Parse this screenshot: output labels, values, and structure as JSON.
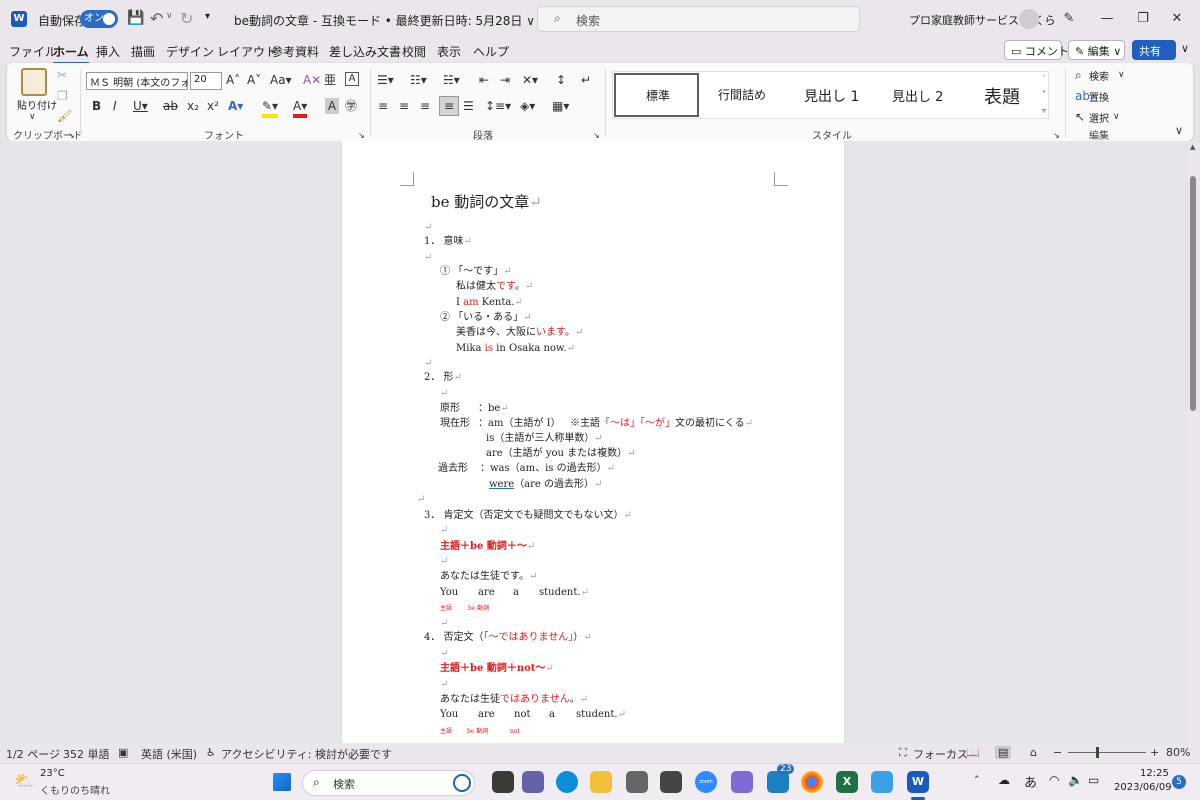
{
  "titlebar": {
    "autosave_label": "自動保存",
    "autosave_state": "オン",
    "doc_title": "be動詞の文章 - 互換モード • 最終更新日時: 5月28日 ∨",
    "search_placeholder": "検索",
    "account_name": "プロ家庭教師サービス さくら"
  },
  "menu": {
    "items": [
      "ファイル",
      "ホーム",
      "挿入",
      "描画",
      "デザイン",
      "レイアウト",
      "参考資料",
      "差し込み文書",
      "校閲",
      "表示",
      "ヘルプ"
    ],
    "comment_button": "コメント",
    "edit_button": "編集",
    "share_button": "共有"
  },
  "ribbon": {
    "paste_label": "貼り付け",
    "clipboard_group": "クリップボード",
    "font_name": "ＭＳ 明朝 (本文のフォ",
    "font_size": "20",
    "font_group": "フォント",
    "paragraph_group": "段落",
    "styles": [
      "標準",
      "行間詰め",
      "見出し 1",
      "見出し 2",
      "表題"
    ],
    "style_group": "スタイル",
    "find_label": "検索",
    "replace_label": "置換",
    "select_label": "選択",
    "edit_group": "編集"
  },
  "document": {
    "title": "be 動詞の文章",
    "s1_heading": "1． 意味",
    "s1_item1": "① 「～です」",
    "s1_ex1_jp_a": "私は健太",
    "s1_ex1_jp_b": "です",
    "s1_ex1_jp_c": "。",
    "s1_ex1_en_a": "I ",
    "s1_ex1_en_b": "am",
    "s1_ex1_en_c": " Kenta.",
    "s1_item2": "② 「いる・ある」",
    "s1_ex2_jp_a": "美香は今、大阪に",
    "s1_ex2_jp_b": "います",
    "s1_ex2_jp_c": "。",
    "s1_ex2_en_a": "Mika ",
    "s1_ex2_en_b": "is",
    "s1_ex2_en_c": " in Osaka now.",
    "s2_heading": "2． 形",
    "s2_base_label": "原形",
    "s2_base_value": "：be",
    "s2_present_label": "現在形",
    "s2_present_1": "：am（主語が I）",
    "s2_present_note_a": "※主語",
    "s2_present_note_b": "「～は」「～が」",
    "s2_present_note_c": "文の最初にくる",
    "s2_present_2": "is（主語が三人称単数）",
    "s2_present_3": "are（主語が you または複数）",
    "s2_past_label": "過去形",
    "s2_past_1": "：was（am、is の過去形）",
    "s2_past_2_a": "were",
    "s2_past_2_b": "（are の過去形）",
    "s3_heading": "3． 肯定文（否定文でも疑問文でもない文）",
    "s3_formula": "主語＋be 動詞＋～",
    "s3_ex_jp": "あなたは生徒です。",
    "s3_ex_en": [
      "You",
      "are",
      "a",
      "student."
    ],
    "s3_tag1": "主語",
    "s3_tag2": "be 動詞",
    "s4_heading_a": "4． 否定文（",
    "s4_heading_b": "「～ではありません」",
    "s4_heading_c": "）",
    "s4_formula": "主語＋be 動詞＋not～",
    "s4_ex_jp_a": "あなたは生徒",
    "s4_ex_jp_b": "ではありません",
    "s4_ex_jp_c": "。",
    "s4_ex_en": [
      "You",
      "are",
      "not",
      "a",
      "student."
    ],
    "s4_tag1": "主語",
    "s4_tag2": "be 動詞",
    "s4_tag3": "not"
  },
  "status": {
    "page": "1/2 ページ",
    "words": "352 単語",
    "language": "英語 (米国)",
    "accessibility": "アクセシビリティ: 検討が必要です",
    "focus": "フォーカス",
    "zoom": "80%"
  },
  "taskbar": {
    "temperature": "23°C",
    "weather": "くもりのち晴れ",
    "search": "検索",
    "ime": "あ",
    "time": "12:25",
    "date": "2023/06/09",
    "badge_count": "23",
    "notification_count": "5"
  },
  "colors": {
    "accent": "#185abd",
    "red_text": "#e31b1b",
    "toggle": "#2b6cc4"
  }
}
